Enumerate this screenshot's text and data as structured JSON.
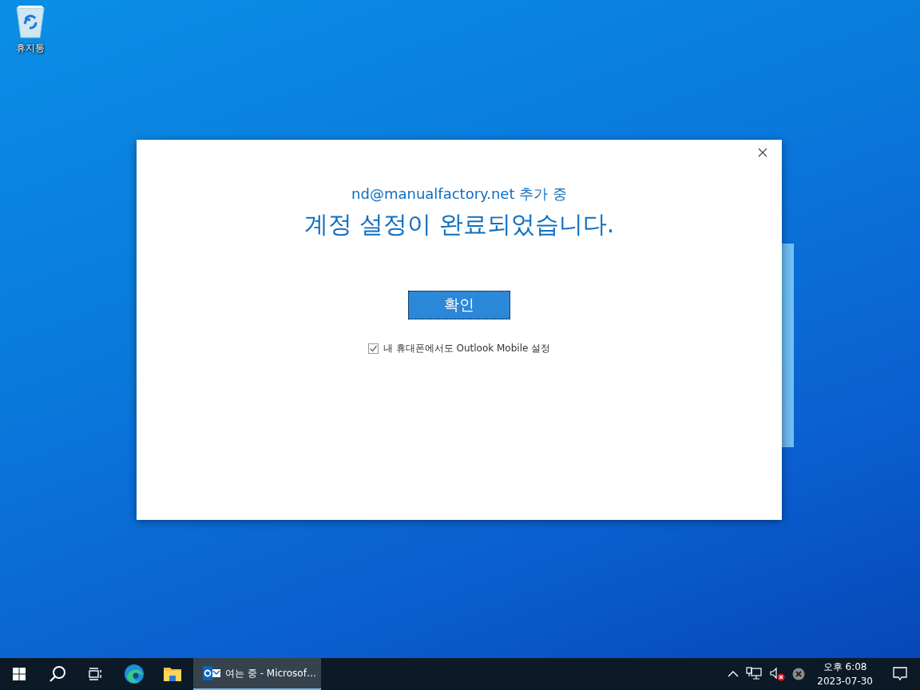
{
  "desktop": {
    "icons": [
      {
        "label": "휴지통"
      }
    ]
  },
  "dialog": {
    "subtitle": "nd@manualfactory.net 추가 중",
    "title": "계정 설정이 완료되었습니다.",
    "button": "확인",
    "checkbox": {
      "label": "내 휴대폰에서도 Outlook Mobile 설정",
      "checked": true
    }
  },
  "taskbar": {
    "apps": [
      {
        "label": "여는 중 - Microsof…",
        "selected": true
      }
    ],
    "clock": {
      "time": "오후 6:08",
      "date": "2023-07-30"
    }
  }
}
